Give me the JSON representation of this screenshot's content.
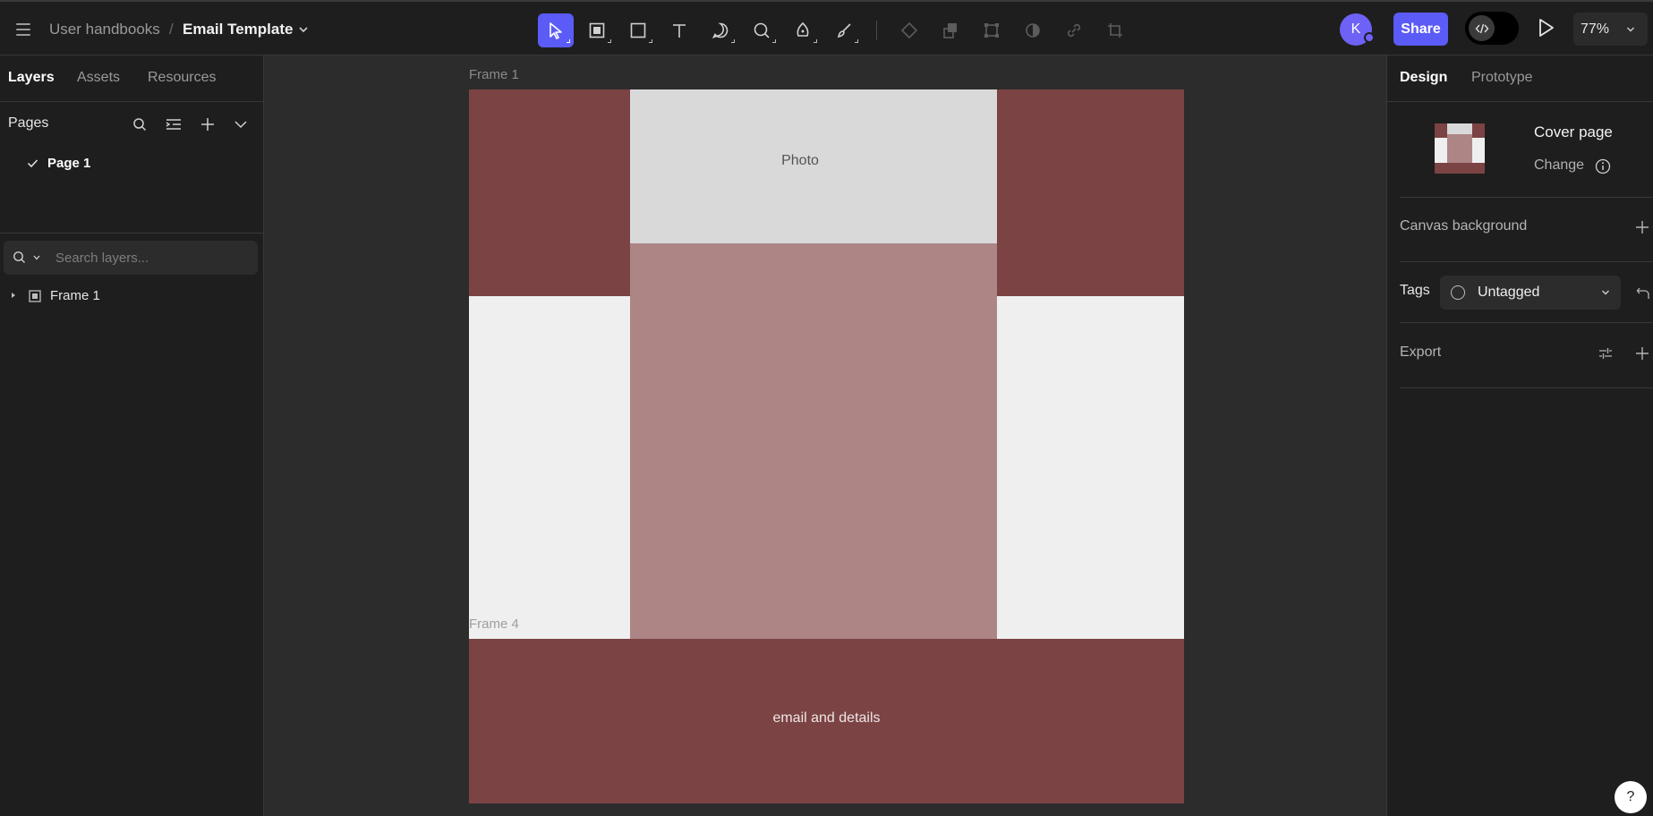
{
  "header": {
    "breadcrumb_parent": "User handbooks",
    "breadcrumb_separator": "/",
    "file_name": "Email Template",
    "avatar_initial": "K",
    "share_label": "Share",
    "zoom_level": "77%",
    "tools": [
      {
        "name": "move-tool",
        "icon": "cursor-icon",
        "active": true
      },
      {
        "name": "board-tool",
        "icon": "board-icon",
        "active": false
      },
      {
        "name": "rectangle-tool",
        "icon": "rectangle-icon",
        "active": false
      },
      {
        "name": "text-tool",
        "icon": "text-icon",
        "active": false
      },
      {
        "name": "comment-tool",
        "icon": "comment-icon",
        "active": false
      },
      {
        "name": "ellipse-tool",
        "icon": "ellipse-icon",
        "active": false
      },
      {
        "name": "pen-tool",
        "icon": "pen-icon",
        "active": false
      },
      {
        "name": "brush-tool",
        "icon": "brush-icon",
        "active": false
      }
    ],
    "accent_color": "#5b5bf7"
  },
  "left_panel": {
    "tabs": [
      "Layers",
      "Assets",
      "Resources"
    ],
    "active_tab": "Layers",
    "pages_title": "Pages",
    "pages": [
      {
        "label": "Page 1",
        "selected": true
      }
    ],
    "search_placeholder": "Search layers...",
    "layers": [
      {
        "label": "Frame 1",
        "type": "frame"
      }
    ]
  },
  "canvas": {
    "frame1_label": "Frame 1",
    "frame4_label": "Frame 4",
    "photo_text": "Photo",
    "email_text": "email and details",
    "colors": {
      "maroon": "#7b4343",
      "rose": "#ad8585",
      "photo_gray": "#d9d9d9",
      "light_gray": "#efefef"
    }
  },
  "right_panel": {
    "tabs": [
      "Design",
      "Prototype"
    ],
    "active_tab": "Design",
    "cover_title": "Cover page",
    "cover_change": "Change",
    "canvas_background_label": "Canvas background",
    "tags_label": "Tags",
    "tags_value": "Untagged",
    "export_label": "Export"
  },
  "help_label": "?"
}
